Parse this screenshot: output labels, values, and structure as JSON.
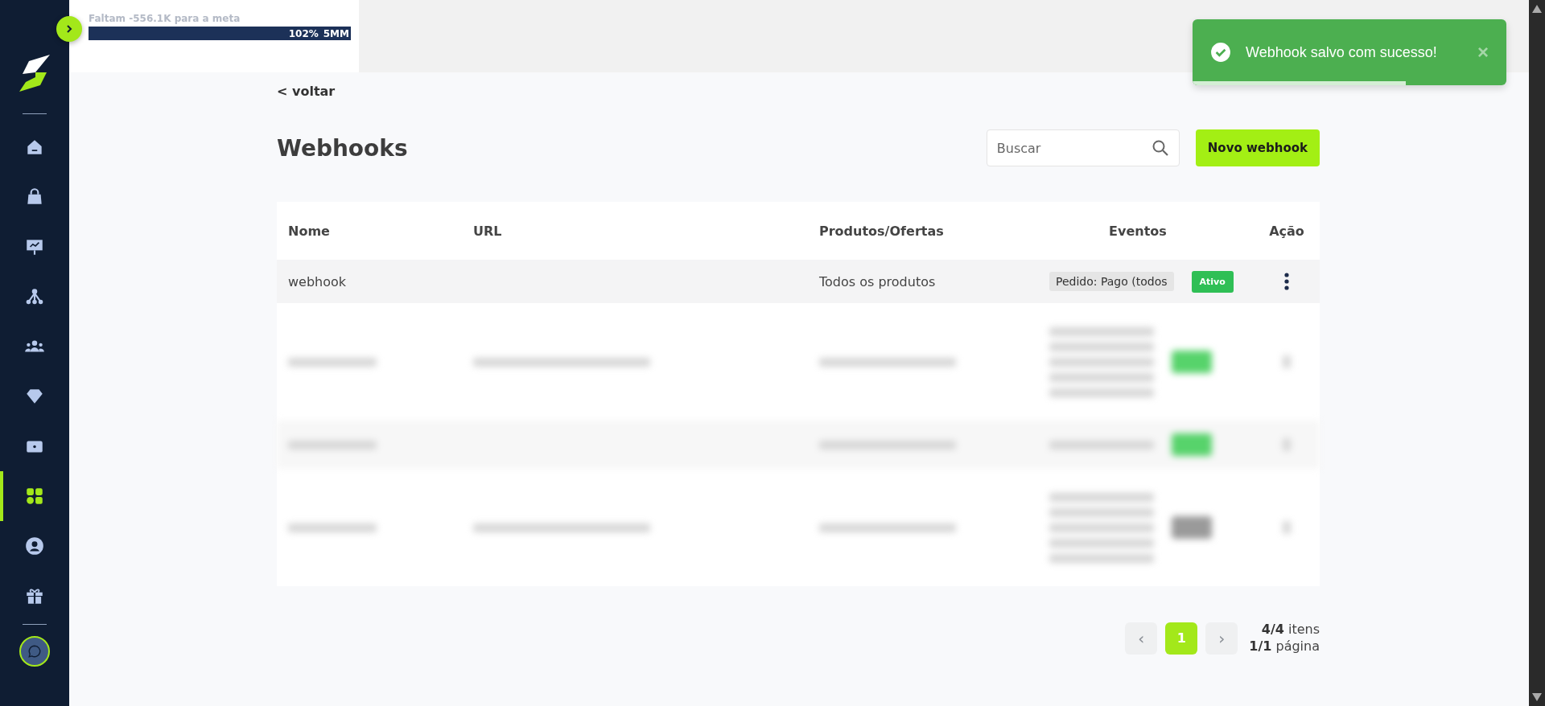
{
  "sidebar": {
    "items": [
      {
        "selected": false
      },
      {
        "selected": false
      },
      {
        "selected": false
      },
      {
        "selected": false
      },
      {
        "selected": false
      },
      {
        "selected": false
      },
      {
        "selected": false
      },
      {
        "selected": true
      },
      {
        "selected": false
      },
      {
        "selected": false
      }
    ]
  },
  "goal": {
    "text": "Faltam -556.1K para a meta",
    "level": 1,
    "percent": "102%",
    "target": "5MM"
  },
  "toast": {
    "message": "Webhook salvo com sucesso!",
    "close": "×",
    "level": 0.68
  },
  "back_link": "< voltar",
  "title": "Webhooks",
  "search": {
    "placeholder": "Buscar"
  },
  "new_button": "Novo webhook",
  "table": {
    "columns": [
      "Nome",
      "URL",
      "Produtos/Ofertas",
      "Eventos",
      "Ação"
    ],
    "rows": [
      {
        "kind": "visible",
        "name": "webhook",
        "products": "Todos os produtos",
        "event": "Pedido: Pago (todos",
        "status": "Ativo",
        "color": "#2fbf55"
      },
      {
        "kind": "blurred_tall",
        "color": "#57d36b"
      },
      {
        "kind": "blurred_short",
        "color": "#57d36b"
      },
      {
        "kind": "blurred_tall",
        "color": "#9a9a9a"
      }
    ]
  },
  "pagination": {
    "prev": "‹",
    "page": "1",
    "next": "›",
    "items_count": "4/4",
    "items_label": "itens",
    "pages_count": "1/1",
    "pages_label": "página"
  }
}
